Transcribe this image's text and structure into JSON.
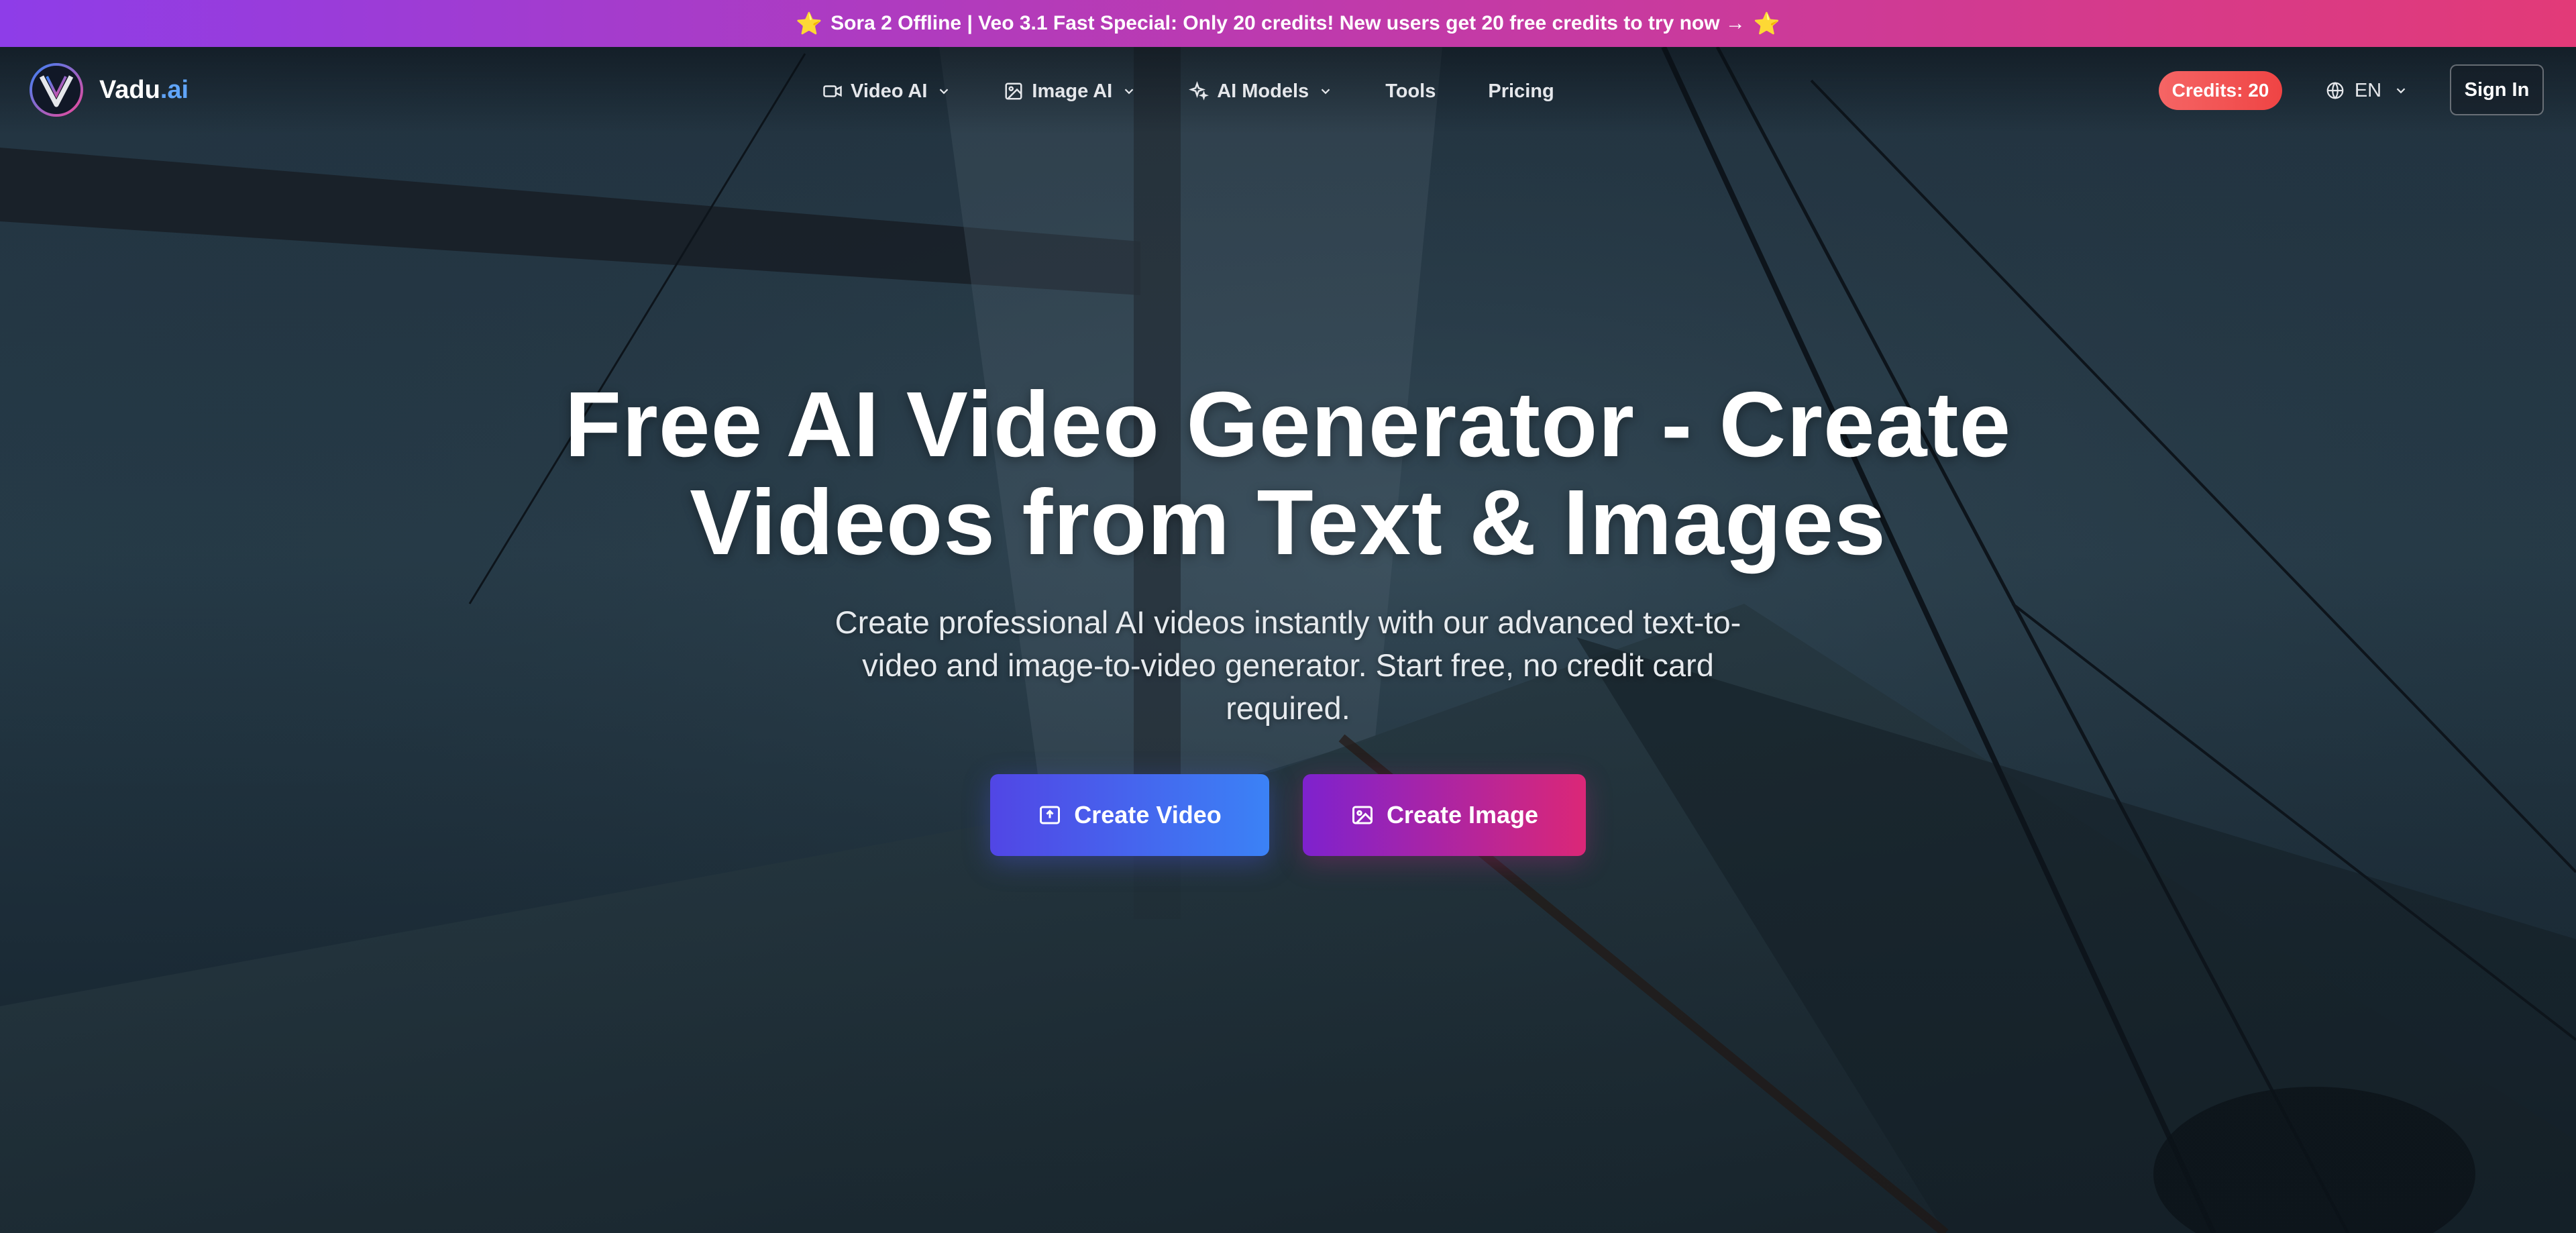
{
  "announcement": {
    "text": "Sora 2 Offline | Veo 3.1 Fast Special: Only 20 credits! New users get 20 free credits to try now →",
    "star": "⭐"
  },
  "brand": {
    "name": "Vadu",
    "tld": ".ai"
  },
  "nav": {
    "items": [
      {
        "label": "Video AI",
        "icon": "video-camera-icon",
        "has_dropdown": true
      },
      {
        "label": "Image AI",
        "icon": "image-icon",
        "has_dropdown": true
      },
      {
        "label": "AI Models",
        "icon": "sparkles-icon",
        "has_dropdown": true
      },
      {
        "label": "Tools",
        "has_dropdown": false
      },
      {
        "label": "Pricing",
        "has_dropdown": false
      }
    ]
  },
  "header": {
    "credits_label": "Credits: 20",
    "language": "EN",
    "signin_label": "Sign In"
  },
  "hero": {
    "title_line1": "Free AI Video Generator - Create",
    "title_line2": "Videos from Text & Images",
    "subtitle": "Create professional AI videos instantly with our advanced text-to-video and image-to-video generator. Start free, no credit card required.",
    "cta_video": "Create Video",
    "cta_image": "Create Image"
  },
  "colors": {
    "banner_start": "#8e3de8",
    "banner_end": "#e23a78",
    "credits_badge": "#ef4444",
    "cta_video_start": "#5146e5",
    "cta_video_end": "#3b82f6",
    "cta_image_start": "#7e22ce",
    "cta_image_end": "#db2777",
    "brand_tld": "#60a5fa"
  }
}
